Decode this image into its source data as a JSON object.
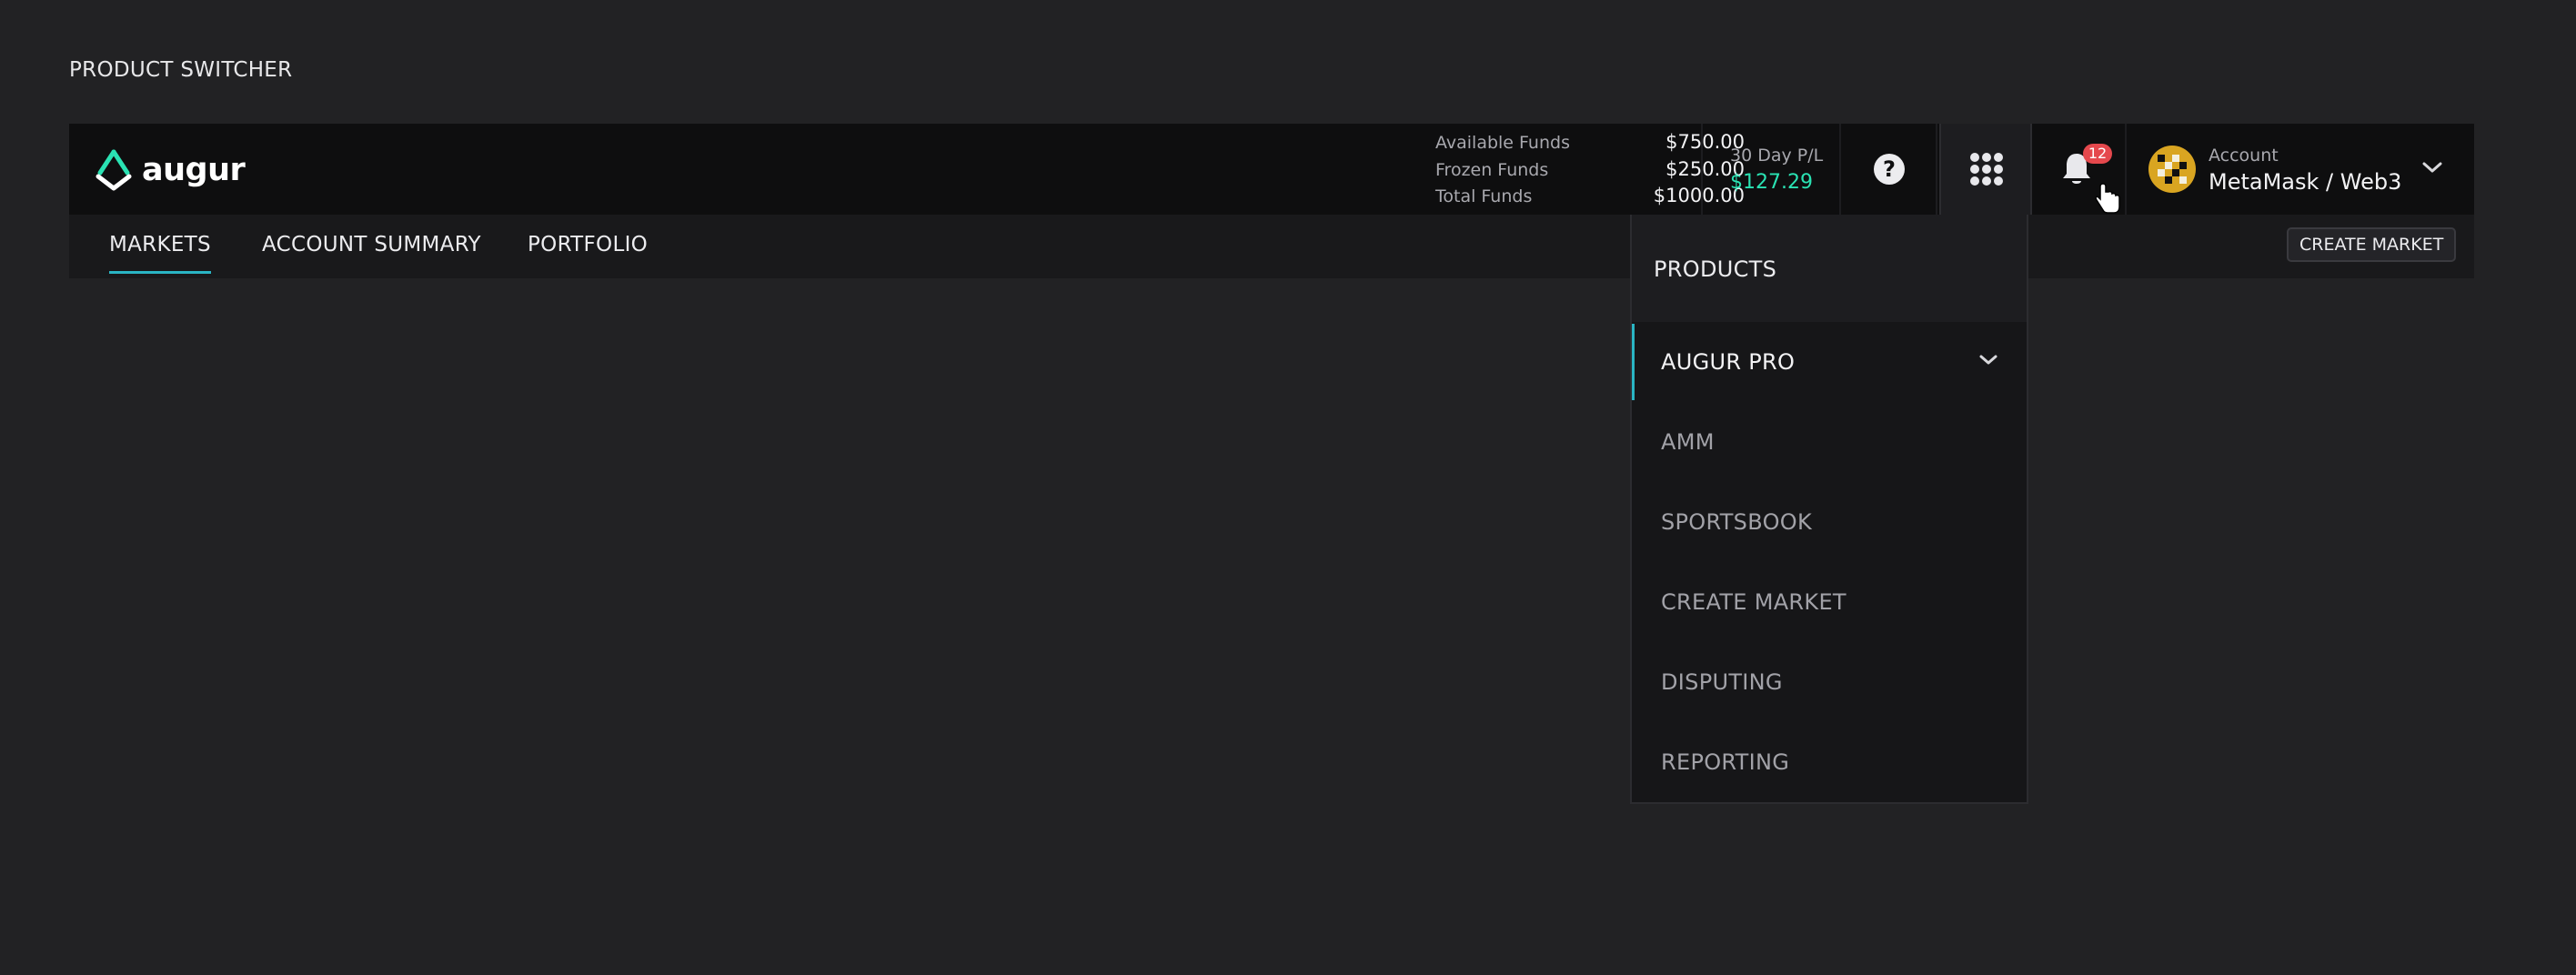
{
  "page": {
    "heading": "PRODUCT SWITCHER"
  },
  "header": {
    "logo_text": "augur",
    "funds": [
      {
        "label": "Available Funds",
        "value": "$750.00"
      },
      {
        "label": "Frozen Funds",
        "value": "$250.00"
      },
      {
        "label": "Total Funds",
        "value": "$1000.00"
      }
    ],
    "pl": {
      "label": "30 Day P/L",
      "value": "$127.29",
      "color": "#2ae2b3"
    },
    "help_icon": "question-circle-icon",
    "apps_icon": "grid-dots-icon",
    "notifications": {
      "icon": "bell-icon",
      "count": "12"
    },
    "account": {
      "label": "Account",
      "name": "MetaMask / Web3"
    }
  },
  "subnav": {
    "tabs": [
      {
        "label": "MARKETS",
        "active": true
      },
      {
        "label": "ACCOUNT SUMMARY",
        "active": false
      },
      {
        "label": "PORTFOLIO",
        "active": false
      }
    ],
    "create_market_label": "CREATE MARKET"
  },
  "product_switcher": {
    "title": "PRODUCTS",
    "items": [
      {
        "label": "AUGUR PRO",
        "active": true
      },
      {
        "label": "AMM",
        "active": false
      },
      {
        "label": "SPORTSBOOK",
        "active": false
      },
      {
        "label": "CREATE MARKET",
        "active": false
      },
      {
        "label": "DISPUTING",
        "active": false
      },
      {
        "label": "REPORTING",
        "active": false
      }
    ]
  },
  "colors": {
    "accent": "#2ab5c4",
    "positive": "#2ae2b3",
    "badge": "#e5484d"
  }
}
